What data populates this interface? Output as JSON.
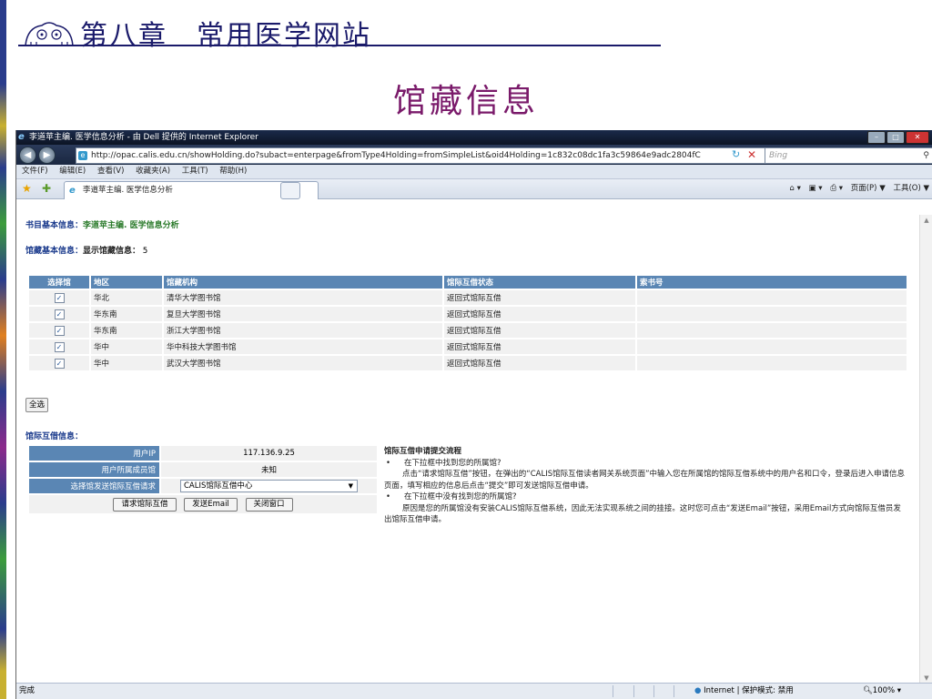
{
  "slide": {
    "title": "第八章　常用医学网站",
    "subtitle": "馆藏信息"
  },
  "browser": {
    "window_title": "李道苹主编. 医学信息分析 - 由 Dell 提供的 Internet Explorer",
    "url": "http://opac.calis.edu.cn/showHolding.do?subact=enterpage&fromType4Holding=fromSimpleList&oid4Holding=1c832c08dc1fa3c59864e9adc2804fC",
    "search_placeholder": "Bing",
    "menu": [
      "文件(F)",
      "编辑(E)",
      "查看(V)",
      "收藏夹(A)",
      "工具(T)",
      "帮助(H)"
    ],
    "tab_label": "李道苹主编. 医学信息分析",
    "command_bar": [
      "页面(P) ▼",
      "工具(O) ▼"
    ],
    "status_text": "完成",
    "zone_text": "Internet | 保护模式: 禁用",
    "zoom": "100%",
    "icons": [
      "ie-logo-icon",
      "back-icon",
      "forward-icon",
      "refresh-icon",
      "stop-icon",
      "search-icon",
      "favorites-star-icon",
      "add-favorites-icon",
      "home-icon",
      "feeds-icon",
      "print-icon",
      "globe-icon",
      "zoom-icon"
    ]
  },
  "page": {
    "bib_label": "书目基本信息：",
    "bib_value": "李道苹主编. 医学信息分析",
    "holding_label": "馆藏基本信息：",
    "holding_count_label": "显示馆藏信息：",
    "holding_count": "5",
    "table_headers": [
      "选择馆",
      "地区",
      "馆藏机构",
      "馆际互借状态",
      "索书号"
    ],
    "rows": [
      {
        "checked": true,
        "region": "华北",
        "library": "清华大学图书馆",
        "status": "返回式馆际互借",
        "callno": ""
      },
      {
        "checked": true,
        "region": "华东南",
        "library": "复旦大学图书馆",
        "status": "返回式馆际互借",
        "callno": ""
      },
      {
        "checked": true,
        "region": "华东南",
        "library": "浙江大学图书馆",
        "status": "返回式馆际互借",
        "callno": ""
      },
      {
        "checked": true,
        "region": "华中",
        "library": "华中科技大学图书馆",
        "status": "返回式馆际互借",
        "callno": ""
      },
      {
        "checked": true,
        "region": "华中",
        "library": "武汉大学图书馆",
        "status": "返回式馆际互借",
        "callno": ""
      }
    ],
    "select_all": "全选",
    "ill_label": "馆际互借信息：",
    "ill_form": {
      "ip_label": "用户IP",
      "ip_value": "117.136.9.25",
      "member_label": "用户所属成员馆",
      "member_value": "未知",
      "send_label": "选择馆发送馆际互借请求",
      "send_value": "CALIS馆际互借中心",
      "buttons": [
        "请求馆际互借",
        "发送Email",
        "关闭窗口"
      ]
    },
    "flow": {
      "title": "馆际互借申请提交流程",
      "bullet1": "在下拉框中找到您的所属馆?",
      "para1": "点击“请求馆际互借”按钮，在弹出的“CALIS馆际互借读者网关系统页面”中输入您在所属馆的馆际互借系统中的用户名和口令，登录后进入申请信息页面，填写相应的信息后点击“提交”即可发送馆际互借申请。",
      "bullet2": "在下拉框中没有找到您的所属馆?",
      "para2": "原因是您的所属馆没有安装CALIS馆际互借系统，因此无法实现系统之间的挂接。这时您可点击“发送Email”按钮，采用Email方式向馆际互借员发出馆际互借申请。"
    }
  }
}
